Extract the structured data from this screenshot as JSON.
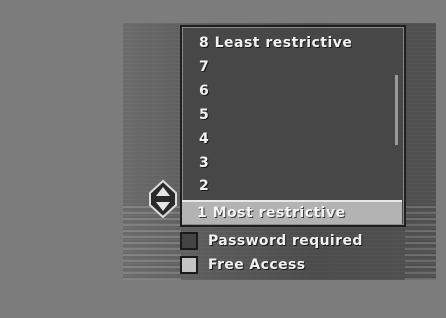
{
  "rating_menu": {
    "levels": [
      {
        "label": "8 Least restrictive"
      },
      {
        "label": "7"
      },
      {
        "label": "6"
      },
      {
        "label": "5"
      },
      {
        "label": "4"
      },
      {
        "label": "3"
      },
      {
        "label": "2"
      }
    ],
    "selected": {
      "label": "1 Most restrictive"
    }
  },
  "legend": {
    "password_required": {
      "label": "Password required",
      "color": "#444444"
    },
    "free_access": {
      "label": "Free Access",
      "color": "#c4c4c4"
    }
  },
  "icons": {
    "selector": "up-down-arrows-icon"
  }
}
